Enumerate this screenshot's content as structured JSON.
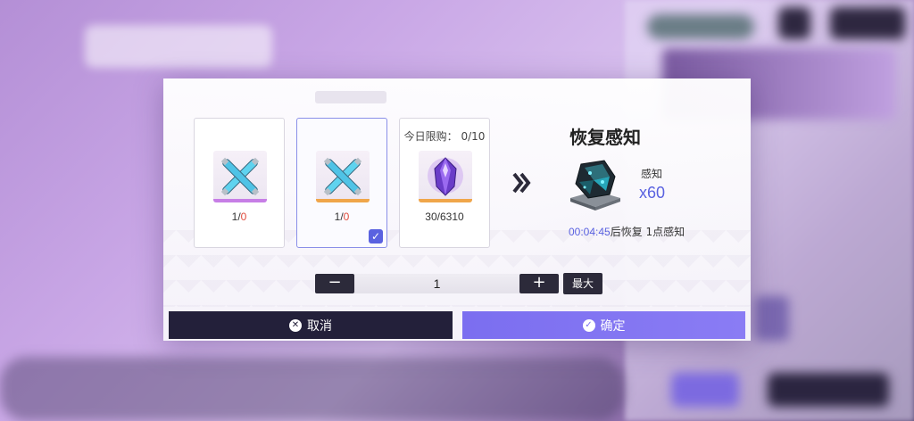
{
  "items": [
    {
      "count_owned": "1",
      "count_sep": "/",
      "count_need": "0",
      "icon": "crossed-energy-rods-icon"
    },
    {
      "count_owned": "1",
      "count_sep": "/",
      "count_need": "0",
      "icon": "crossed-energy-rods-icon",
      "selected": true
    },
    {
      "limit_label": "今日限购：",
      "limit_value": "0/10",
      "count": "30/6310",
      "icon": "purple-crystal-icon"
    }
  ],
  "reward": {
    "title": "恢复感知",
    "label": "感知",
    "amount": "x60",
    "icon": "perception-crystal-icon",
    "recover_time": "00:04:45",
    "recover_text": "后恢复 1点感知"
  },
  "stepper": {
    "minus": "−",
    "value": "1",
    "plus": "+",
    "max_label": "最大"
  },
  "buttons": {
    "cancel_label": "取消",
    "confirm_label": "确定"
  },
  "colors": {
    "accent": "#5a62e0",
    "confirm": "#7b6ef0",
    "dark": "#23203a",
    "shortage": "#e04b3c"
  }
}
